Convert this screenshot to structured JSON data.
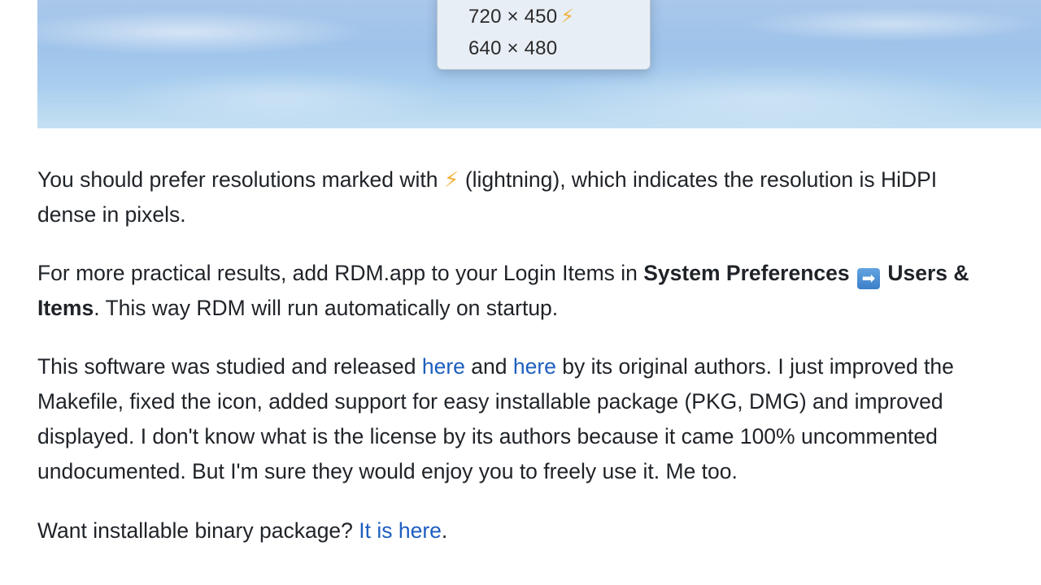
{
  "hero": {
    "menu_items": [
      {
        "label": "720 × 450",
        "badge": "⚡"
      },
      {
        "label": "640 × 480"
      }
    ]
  },
  "paragraph1": {
    "line1_before": "You should prefer resolutions marked with ",
    "bolt": "⚡",
    "line1_after": " (lightning), which indicates the resolution is HiDPI",
    "line2": "dense in pixels."
  },
  "paragraph2": {
    "line1_before": "For more practical results, add RDM.app to your Login Items in ",
    "bold1": "System Preferences",
    "arrow": "➡",
    "bold2": " Users &",
    "bold3": "Items",
    "line2_after": ". This way RDM will run automatically on startup."
  },
  "paragraph3": {
    "line1_before": "This software was studied and released ",
    "link1": "here",
    "line1_mid": " and ",
    "link2": "here",
    "line1_after": " by its original authors. I just improved the",
    "line2": "Makefile, fixed the icon, added support for easy installable package (PKG, DMG) and improved",
    "line3": "displayed. I don't know what is the license by its authors because it came 100% uncommented",
    "line4": "undocumented. But I'm sure they would enjoy you to freely use it. Me too."
  },
  "paragraph4": {
    "before": "Want installable binary package? ",
    "link": "It is here",
    "after": "."
  }
}
